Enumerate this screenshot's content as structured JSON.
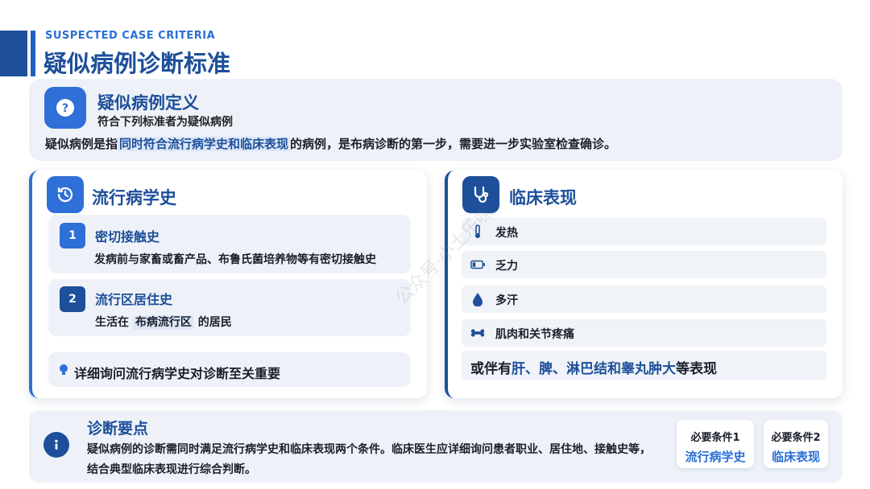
{
  "header": {
    "subtitle": "SUSPECTED CASE CRITERIA",
    "title": "疑似病例诊断标准"
  },
  "definition": {
    "icon": "question-icon",
    "title": "疑似病例定义",
    "subtitle": "符合下列标准者为疑似病例",
    "desc_pre": "疑似病例是指",
    "desc_highlight": "同时符合流行病学史和临床表现",
    "desc_post": "的病例，是布病诊断的第一步，需要进一步实验室检查确诊。"
  },
  "epidemiology": {
    "icon": "history-icon",
    "title": "流行病学史",
    "items": [
      {
        "num": "1",
        "title": "密切接触史",
        "desc_pre": "发病前与家畜或畜产品、布鲁氏菌培养物等有密切接触史",
        "highlight": "",
        "desc_post": ""
      },
      {
        "num": "2",
        "title": "流行区居住史",
        "desc_pre": "生活在",
        "highlight": "布病流行区",
        "desc_post": "的居民"
      }
    ],
    "tip_icon": "lightbulb-icon",
    "tip": "详细询问流行病学史对诊断至关重要"
  },
  "clinical": {
    "icon": "stethoscope-icon",
    "title": "临床表现",
    "symptoms": [
      {
        "icon": "thermometer-icon",
        "label": "发热"
      },
      {
        "icon": "battery-low-icon",
        "label": "乏力"
      },
      {
        "icon": "droplet-icon",
        "label": "多汗"
      },
      {
        "icon": "bone-icon",
        "label": "肌肉和关节疼痛"
      }
    ],
    "extra_pre": "或伴有",
    "extra_highlight": "肝、脾、淋巴结和睾丸肿大",
    "extra_post": "等表现"
  },
  "key_points": {
    "icon": "info-icon",
    "title": "诊断要点",
    "text": "疑似病例的诊断需同时满足流行病学史和临床表现两个条件。临床医生应详细询问患者职业、居住地、接触史等，结合典型临床表现进行综合判断。",
    "conditions": [
      {
        "label": "必要条件1",
        "value": "流行病学史"
      },
      {
        "label": "必要条件2",
        "value": "临床表现"
      }
    ]
  },
  "watermark": "公众号·小土乐咪",
  "colors": {
    "primary": "#1d4f9a",
    "accent": "#2f6fd8",
    "card_bg": "#eef2f8"
  }
}
